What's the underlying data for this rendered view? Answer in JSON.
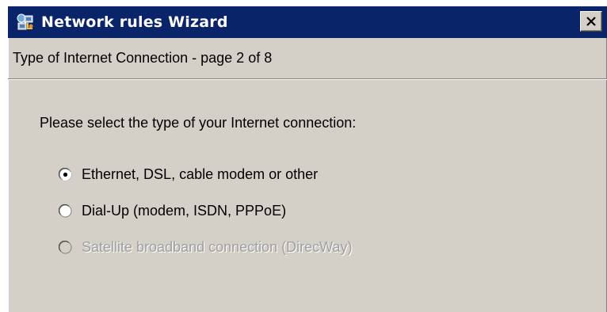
{
  "window": {
    "title": "Network rules Wizard",
    "title_icon": "network-wizard-icon",
    "close_icon": "close-icon"
  },
  "page": {
    "subtitle": "Type of Internet Connection - page 2 of 8",
    "prompt": "Please select the type of your Internet connection:"
  },
  "connection_options": [
    {
      "label": "Ethernet, DSL, cable modem or other",
      "selected": true,
      "enabled": true
    },
    {
      "label": "Dial-Up (modem, ISDN, PPPoE)",
      "selected": false,
      "enabled": true
    },
    {
      "label": "Satellite broadband connection (DirecWay)",
      "selected": false,
      "enabled": false
    }
  ],
  "colors": {
    "titlebar": "#0a246a",
    "dialog_background": "#d4d0c8",
    "disabled_text": "#a0a0a0"
  }
}
